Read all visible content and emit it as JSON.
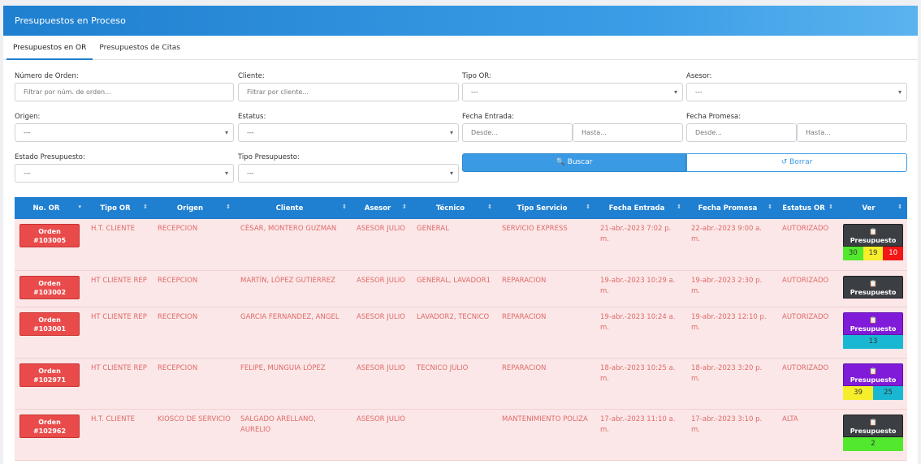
{
  "header": {
    "title": "Presupuestos en Proceso"
  },
  "tabs": [
    {
      "label": "Presupuestos en OR"
    },
    {
      "label": "Presupuestos de Citas"
    }
  ],
  "filters": {
    "orden": {
      "label": "Número de Orden:",
      "placeholder": "Filtrar por núm. de orden..."
    },
    "cliente": {
      "label": "Cliente:",
      "placeholder": "Filtrar por cliente..."
    },
    "tipo_or": {
      "label": "Tipo OR:",
      "value": "---"
    },
    "asesor": {
      "label": "Asesor:",
      "value": "---"
    },
    "origen": {
      "label": "Origen:",
      "value": "---"
    },
    "estatus": {
      "label": "Estatus:",
      "value": "---"
    },
    "fecha_entrada": {
      "label": "Fecha Entrada:",
      "desde": "Desde...",
      "hasta": "Hasta..."
    },
    "fecha_promesa": {
      "label": "Fecha Promesa:",
      "desde": "Desde...",
      "hasta": "Hasta..."
    },
    "estado_presupuesto": {
      "label": "Estado Presupuesto:",
      "value": "---"
    },
    "tipo_presupuesto": {
      "label": "Tipo Presupuesto:",
      "value": "---"
    }
  },
  "buttons": {
    "search": "Buscar",
    "clear": "Borrar",
    "search_icon": "search-icon",
    "clear_icon": "undo-icon"
  },
  "table": {
    "columns": [
      "No. OR",
      "Tipo OR",
      "Origen",
      "Cliente",
      "Asesor",
      "Técnico",
      "Tipo Servicio",
      "Fecha Entrada",
      "Fecha Promesa",
      "Estatus OR",
      "Ver"
    ],
    "rows": [
      {
        "orden_label": "Orden",
        "orden": "#103005",
        "tipo": "H.T. CLIENTE",
        "origen": "RECEPCION",
        "cliente": "CÉSAR, MONTERO GUZMAN",
        "asesor": "ASESOR JULIO",
        "tecnico": "GENERAL",
        "servicio": "SERVICIO EXPRESS",
        "entrada": "21-abr.-2023 7:02 p. m.",
        "promesa": "22-abr.-2023 9:00 a. m.",
        "estatus": "AUTORIZADO",
        "pres_label": "Presupuesto",
        "pres_color": "gray",
        "chips": [
          {
            "v": "30",
            "c": "c-green"
          },
          {
            "v": "19",
            "c": "c-yellow"
          },
          {
            "v": "10",
            "c": "c-red"
          }
        ]
      },
      {
        "orden_label": "Orden",
        "orden": "#103002",
        "tipo": "HT CLIENTE REP",
        "origen": "RECEPCION",
        "cliente": "MARTÍN, LÓPEZ GUTIERREZ",
        "asesor": "ASESOR JULIO",
        "tecnico": "GENERAL, LAVADOR1",
        "servicio": "REPARACION",
        "entrada": "19-abr.-2023 10:29 a. m.",
        "promesa": "19-abr.-2023 2:30 p. m.",
        "estatus": "AUTORIZADO",
        "pres_label": "Presupuesto",
        "pres_color": "gray",
        "chips": []
      },
      {
        "orden_label": "Orden",
        "orden": "#103001",
        "tipo": "HT CLIENTE REP",
        "origen": "RECEPCION",
        "cliente": "GARCIA FERNANDEZ, ANGEL",
        "asesor": "ASESOR JULIO",
        "tecnico": "LAVADOR2, TECNICO",
        "servicio": "REPARACION",
        "entrada": "19-abr.-2023 10:24 a. m.",
        "promesa": "19-abr.-2023 12:10 p. m.",
        "estatus": "AUTORIZADO",
        "pres_label": "Presupuesto",
        "pres_color": "purple",
        "chips": [
          {
            "v": "13",
            "c": "c-cyan"
          }
        ]
      },
      {
        "orden_label": "Orden",
        "orden": "#102971",
        "tipo": "HT CLIENTE REP",
        "origen": "RECEPCION",
        "cliente": "FELIPE, MUNGUIA LÓPEZ",
        "asesor": "ASESOR JULIO",
        "tecnico": "TECNICO JULIO",
        "servicio": "REPARACION",
        "entrada": "18-abr.-2023 10:25 a. m.",
        "promesa": "18-abr.-2023 3:20 p. m.",
        "estatus": "AUTORIZADO",
        "pres_label": "Presupuesto",
        "pres_color": "purple",
        "chips": [
          {
            "v": "39",
            "c": "c-yellow"
          },
          {
            "v": "25",
            "c": "c-cyan"
          }
        ]
      },
      {
        "orden_label": "Orden",
        "orden": "#102962",
        "tipo": "H.T. CLIENTE",
        "origen": "KIOSCO DE SERVICIO",
        "cliente": "SALGADO ARELLANO, AURELIO",
        "asesor": "ASESOR JULIO",
        "tecnico": "",
        "servicio": "MANTENIMIENTO POLIZA",
        "entrada": "17-abr.-2023 11:10 a. m.",
        "promesa": "17-abr.-2023 3:10 p. m.",
        "estatus": "ALTA",
        "pres_label": "Presupuesto",
        "pres_color": "gray",
        "chips": [
          {
            "v": "2",
            "c": "c-green"
          }
        ]
      }
    ]
  }
}
